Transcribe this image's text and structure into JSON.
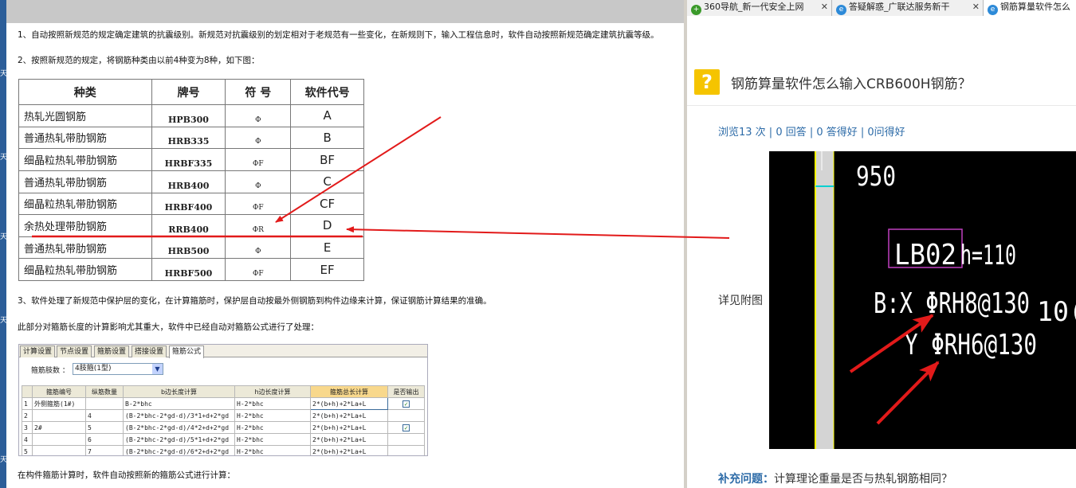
{
  "left_doc": {
    "side_glyphs": [
      "天",
      "天",
      "天",
      "天",
      "天"
    ],
    "para1": "1、自动按照新规范的规定确定建筑的抗震级别。新规范对抗震级别的划定相对于老规范有一些变化，在新规则下，输入工程信息时，软件自动按照新规范确定建筑抗震等级。",
    "para2": "2、按照新规范的规定，将钢筋种类由以前4种变为8种，如下图：",
    "rebar_table": {
      "headers": [
        "种类",
        "牌号",
        "符  号",
        "软件代号"
      ],
      "rows": [
        {
          "kind": "热轧光圆钢筋",
          "grade": "HPB300",
          "symbol": "Φ",
          "code": "A"
        },
        {
          "kind": "普通热轧带肋钢筋",
          "grade": "HRB335",
          "symbol": "Φ",
          "code": "B"
        },
        {
          "kind": "细晶粒热轧带肋钢筋",
          "grade": "HRBF335",
          "symbol": "ΦF",
          "code": "BF"
        },
        {
          "kind": "普通热轧带肋钢筋",
          "grade": "HRB400",
          "symbol": "Φ",
          "code": "C"
        },
        {
          "kind": "细晶粒热轧带肋钢筋",
          "grade": "HRBF400",
          "symbol": "ΦF",
          "code": "CF"
        },
        {
          "kind": "余热处理带肋钢筋",
          "grade": "RRB400",
          "symbol": "ΦR",
          "code": "D"
        },
        {
          "kind": "普通热轧带肋钢筋",
          "grade": "HRB500",
          "symbol": "Φ",
          "code": "E"
        },
        {
          "kind": "细晶粒热轧带肋钢筋",
          "grade": "HRBF500",
          "symbol": "ΦF",
          "code": "EF"
        }
      ]
    },
    "para3": "3、软件处理了新规范中保护层的变化，在计算箍筋时，保护层自动按最外侧钢筋到构件边缘来计算，保证钢筋计算结果的准确。",
    "para4": "此部分对箍筋长度的计算影响尤其重大，软件中已经自动对箍筋公式进行了处理：",
    "software": {
      "tabs": [
        "计算设置",
        "节点设置",
        "箍筋设置",
        "搭接设置",
        "箍筋公式"
      ],
      "active_tab": 4,
      "limbs_label": "箍筋肢数 ：",
      "limbs_value": "4肢箍(1型)",
      "headers": [
        "",
        "箍筋编号",
        "纵筋数量",
        "b边长度计算",
        "h边长度计算",
        "箍筋总长计算",
        "是否输出"
      ],
      "rows": [
        {
          "no": "1",
          "id": "外侧箍筋(1#)",
          "count": "",
          "b": "B-2*bhc",
          "h": "H-2*bhc",
          "total": "2*(b+h)+2*La+L",
          "out": "✓"
        },
        {
          "no": "2",
          "id": "",
          "count": "4",
          "b": "(B-2*bhc-2*gd-d)/3*1+d+2*gd",
          "h": "H-2*bhc",
          "total": "2*(b+h)+2*La+L",
          "out": ""
        },
        {
          "no": "3",
          "id": "2#",
          "count": "5",
          "b": "(B-2*bhc-2*gd-d)/4*2+d+2*gd",
          "h": "H-2*bhc",
          "total": "2*(b+h)+2*La+L",
          "out": "✓"
        },
        {
          "no": "4",
          "id": "",
          "count": "6",
          "b": "(B-2*bhc-2*gd-d)/5*1+d+2*gd",
          "h": "H-2*bhc",
          "total": "2*(b+h)+2*La+L",
          "out": ""
        },
        {
          "no": "5",
          "id": "",
          "count": "7",
          "b": "(B-2*bhc-2*gd-d)/6*2+d+2*gd",
          "h": "H-2*bhc",
          "total": "2*(b+h)+2*La+L",
          "out": ""
        }
      ]
    },
    "para5": "在构件箍筋计算时，软件自动按照新的箍筋公式进行计算："
  },
  "browser_tabs": [
    {
      "title": "360导航_新一代安全上网",
      "icon": "+",
      "icon_color": "#3a9a2a",
      "active": false
    },
    {
      "title": "答疑解惑_广联达服务新干",
      "icon": "e",
      "icon_color": "#2d8ad8",
      "active": false
    },
    {
      "title": "钢筋算量软件怎么",
      "icon": "e",
      "icon_color": "#2d8ad8",
      "active": true
    }
  ],
  "question": {
    "icon": "?",
    "title": "钢筋算量软件怎么输入CRB600H钢筋？",
    "stats": "浏览13 次 | 0 回答 | 0 答得好 | 0问得好",
    "detail": "详见附图",
    "supplement_label": "补充问题：",
    "supplement_text": "计算理论重量是否与热轧钢筋相同？"
  },
  "cad": {
    "dim": "950",
    "label": "LB02",
    "thickness": "h=110",
    "bx": "B:X ΦRH8@130",
    "by": "Y ΦRH6@130",
    "edge": "10("
  },
  "colors": {
    "accent_red": "#e21a1a",
    "link_blue": "#2e6ca8",
    "question_yellow": "#f5c400",
    "cad_magenta": "#c040c0"
  }
}
